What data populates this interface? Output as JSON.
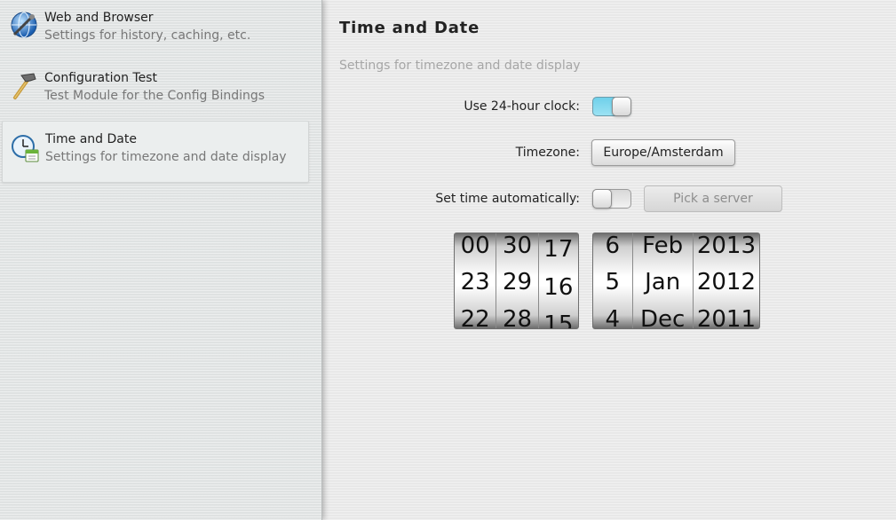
{
  "sidebar": {
    "items": [
      {
        "title": "Web and Browser",
        "description": "Settings for history, caching, etc.",
        "icon": "globe-icon"
      },
      {
        "title": "Configuration Test",
        "description": "Test Module for the Config Bindings",
        "icon": "hammer-icon"
      },
      {
        "title": "Time and Date",
        "description": "Settings for timezone and date display",
        "icon": "clock-calendar-icon",
        "selected": true
      }
    ]
  },
  "main": {
    "title": "Time and Date",
    "subtitle": "Settings for timezone and date display",
    "clock24": {
      "label": "Use 24-hour clock:",
      "value": true
    },
    "timezone": {
      "label": "Timezone:",
      "value": "Europe/Amsterdam"
    },
    "auto_time": {
      "label": "Set time automatically:",
      "value": false,
      "server_button": "Pick a server"
    },
    "time_picker": {
      "hours": [
        "00",
        "23",
        "22"
      ],
      "minutes": [
        "30",
        "29",
        "28"
      ],
      "seconds": [
        "17",
        "16",
        "15"
      ]
    },
    "date_picker": {
      "days": [
        "6",
        "5",
        "4"
      ],
      "months": [
        "Feb",
        "Jan",
        "Dec"
      ],
      "years": [
        "2013",
        "2012",
        "2011"
      ]
    }
  },
  "colors": {
    "toggle_on": "#7fd8ee",
    "sidebar_bg": "#e3e6e6",
    "main_bg": "#ececec"
  }
}
